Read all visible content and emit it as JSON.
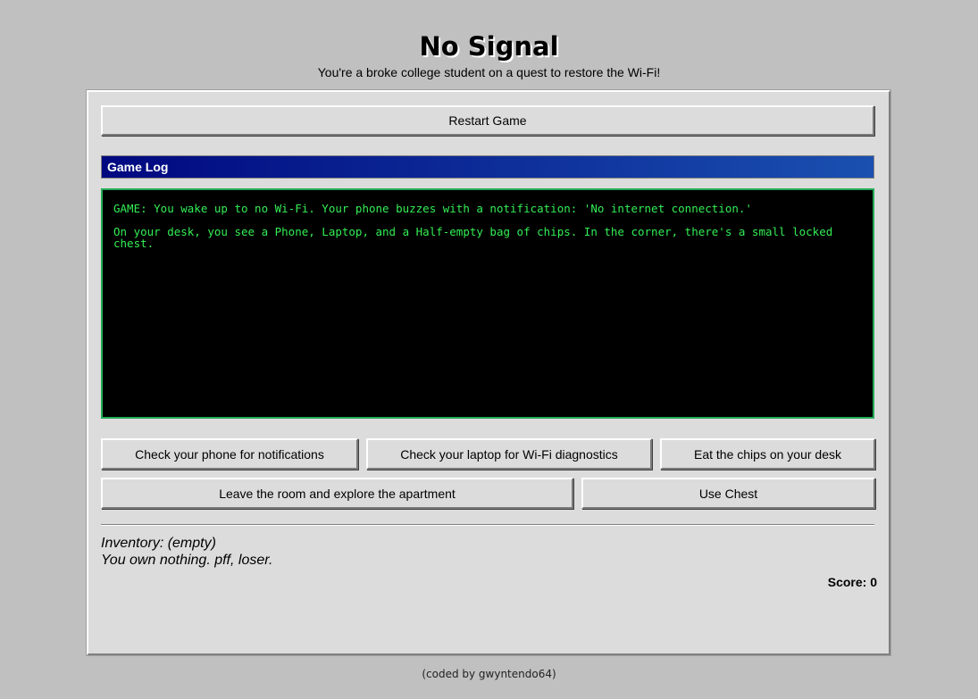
{
  "header": {
    "title": "No Signal",
    "subtitle": "You're a broke college student on a quest to restore the Wi-Fi!"
  },
  "controls": {
    "restart_label": "Restart Game"
  },
  "game_log": {
    "header": "Game Log",
    "lines": [
      "GAME: You wake up to no Wi-Fi. Your phone buzzes with a notification: 'No internet connection.'",
      "On your desk, you see a Phone, Laptop, and a Half-empty bag of chips. In the corner, there's a small locked chest."
    ]
  },
  "actions": [
    "Check your phone for notifications",
    "Check your laptop for Wi-Fi diagnostics",
    "Eat the chips on your desk",
    "Leave the room and explore the apartment",
    "Use Chest"
  ],
  "inventory": {
    "title": "Inventory: (empty)",
    "description": "You own nothing. pff, loser."
  },
  "score": {
    "label": "Score: 0"
  },
  "footer": "(coded by gwyntendo64)",
  "colors": {
    "page_bg": "#c0c0c0",
    "panel_bg": "#dcdcdc",
    "log_bg": "#000000",
    "log_text": "#33ee55",
    "log_border": "#22aa55",
    "header_gradient_start": "#000880",
    "header_gradient_end": "#1a50b0"
  }
}
